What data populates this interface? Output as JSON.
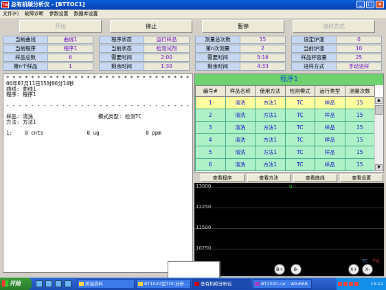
{
  "window": {
    "title": "总有机碳分析仪 - [BTTOC1]",
    "icon_text": "TOC"
  },
  "menu": [
    "文件(F)",
    "故障诊断",
    "参数设置",
    "数据库设置"
  ],
  "controls": {
    "start": "开始",
    "stop": "停止",
    "pause": "暂停",
    "inject": "进样方式"
  },
  "info": [
    [
      {
        "label": "当前曲线",
        "value": "曲线1"
      },
      {
        "label": "当前程序",
        "value": "程序1"
      },
      {
        "label": "样品总数",
        "value": "6"
      },
      {
        "label": "第n个样品",
        "value": "1"
      }
    ],
    [
      {
        "label": "程序状态",
        "value": "运行样品"
      },
      {
        "label": "当前状态",
        "value": "检测试剂"
      },
      {
        "label": "需要时间",
        "value": "2:00"
      },
      {
        "label": "剩余时间",
        "value": "1:30"
      }
    ],
    [
      {
        "label": "测量总次数",
        "value": "15"
      },
      {
        "label": "第n次测量",
        "value": "2"
      },
      {
        "label": "需要时间",
        "value": "5:16"
      },
      {
        "label": "剩余时间",
        "value": "4:33"
      }
    ],
    [
      {
        "label": "设定炉温",
        "value": "0"
      },
      {
        "label": "当前炉温",
        "value": "10"
      },
      {
        "label": "样品杯容量",
        "value": "25"
      },
      {
        "label": "进样方式",
        "value": "手动进样"
      }
    ]
  ],
  "log": {
    "stars": "* * * * * * * * * * * * * * * * * * * * * * * * * * * * * * * * * * * * * * * * * * *",
    "line1": "06年07月11日15时06分14秒",
    "line2": "曲线: 曲线1",
    "line3": "程序: 程序1",
    "dashes": "- - - - - - - - - - - - - - - - - - - - - - - - - - - - - - - - - - - - - - - - - - - -",
    "line4": "样品: 清洗                     模式类型: 检测TC",
    "line5": "方法: 方法1",
    "line6": "1:    0 cnts              0 ug               0 ppm"
  },
  "program": {
    "title": "程序1",
    "headers": [
      "编号#",
      "样品名称",
      "使用方法",
      "检测模式",
      "运行类型",
      "测量次数"
    ],
    "rows": [
      [
        "1",
        "清洗",
        "方法1",
        "TC",
        "样品",
        "15"
      ],
      [
        "2",
        "清洗",
        "方法1",
        "TC",
        "样品",
        "15"
      ],
      [
        "3",
        "清洗",
        "方法1",
        "TC",
        "样品",
        "15"
      ],
      [
        "4",
        "清洗",
        "方法1",
        "TC",
        "样品",
        "15"
      ],
      [
        "5",
        "清洗",
        "方法1",
        "TC",
        "样品",
        "15"
      ],
      [
        "6",
        "清洗",
        "方法1",
        "TC",
        "样品",
        "15"
      ]
    ]
  },
  "view_buttons": [
    "查看程序",
    "查看方法",
    "查看曲线",
    "查看设置"
  ],
  "graph": {
    "y_ticks": [
      "13000",
      "12250",
      "11500",
      "10750"
    ],
    "zero_label": "0",
    "legend_tc": "TC",
    "legend_tic": "TIC",
    "btn_b_plus": "B+",
    "btn_b_minus": "B-",
    "btn_x_plus": "X+",
    "btn_x_minus": "X-"
  },
  "taskbar": {
    "start": "开始",
    "tasks": [
      "美福资料",
      "BT1020型TOC分析...",
      "总有机碳分析仪",
      "BT1020.rar - WinRAR"
    ],
    "clock": "15:12"
  },
  "colors": {
    "title_blue": "#0a5fd8",
    "table_green": "#aef0c8",
    "selected_row": "#ffffa0",
    "value_purple": "#6010c0"
  }
}
